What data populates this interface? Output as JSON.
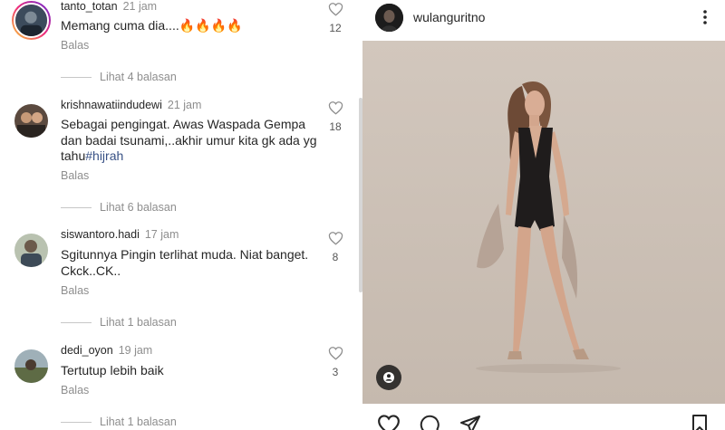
{
  "comments": [
    {
      "user": "tanto_totan",
      "time": "21 jam",
      "text": "Memang cuma dia....🔥🔥🔥🔥",
      "reply": "Balas",
      "likes": "12"
    },
    {
      "user": "krishnawatiindudewi",
      "time": "21 jam",
      "text": "Sebagai pengingat. Awas Waspada Gempa dan badai tsunami,..akhir umur kita gk ada yg tahu",
      "hashtag": "#hijrah",
      "reply": "Balas",
      "likes": "18"
    },
    {
      "user": "siswantoro.hadi",
      "time": "17 jam",
      "text": "Sgitunnya Pingin terlihat muda. Niat banget. Ckck..CK..",
      "reply": "Balas",
      "likes": "8"
    },
    {
      "user": "dedi_oyon",
      "time": "19 jam",
      "text": "Tertutup lebih baik",
      "reply": "Balas",
      "likes": "3"
    }
  ],
  "view_replies": [
    "Lihat 4 balasan",
    "Lihat 6 balasan",
    "Lihat 1 balasan",
    "Lihat 1 balasan"
  ],
  "post": {
    "username": "wulanguritno",
    "icons": {
      "more": "more-vertical-icon",
      "tag": "person-tag-icon",
      "like": "heart-icon",
      "comment": "comment-icon",
      "share": "share-icon",
      "save": "bookmark-icon"
    }
  },
  "colors": {
    "text": "#262626",
    "secondary": "#8e8e8e",
    "hashtag": "#385185",
    "photo_bg": "#cbc0b6"
  }
}
